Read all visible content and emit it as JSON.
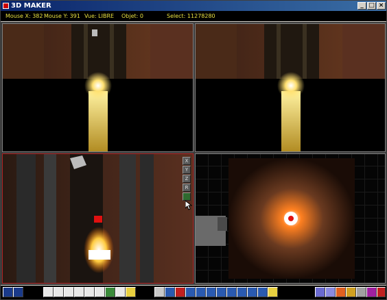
{
  "window": {
    "title": "3D MAKER",
    "buttons": {
      "minimize": "_",
      "maximize": "□",
      "close": "×"
    }
  },
  "status": {
    "mouse_x": "Mouse X: 382",
    "mouse_y": "Mouse Y: 391",
    "view": "Vue: LIBRE",
    "object": "Objet: 0",
    "select": "Select: 11278280"
  },
  "axis_buttons": [
    "X",
    "Y",
    "Z",
    "R"
  ],
  "toolbar": {
    "groups": [
      {
        "name": "file",
        "icons": [
          "save-icon",
          "save-as-icon"
        ]
      },
      {
        "name": "objects",
        "icons": [
          "cube-icon",
          "sphere-icon",
          "cylinder-icon",
          "cone-icon",
          "wrench-icon",
          "box-icon",
          "group-icon",
          "magnet-icon",
          "light-bulb-icon"
        ]
      },
      {
        "name": "view",
        "icons": [
          "eye-icon",
          "move-horizontal-icon",
          "move-red-icon",
          "move-down-icon",
          "rotate-left-icon",
          "rotate-right-icon",
          "rotate-icon",
          "fit-icon",
          "scale-icon",
          "mirror-icon",
          "align-icon",
          "cube-view-icon"
        ]
      },
      {
        "name": "render",
        "icons": [
          "texture-icon",
          "grid-icon",
          "fire-icon",
          "drop-icon",
          "settings-icon",
          "help-icon",
          "exit-icon"
        ]
      }
    ]
  },
  "colors": {
    "title_start": "#0a246a",
    "title_end": "#3a6ea5",
    "status_text": "#e8e040",
    "active_viewport_border": "#b02020"
  }
}
